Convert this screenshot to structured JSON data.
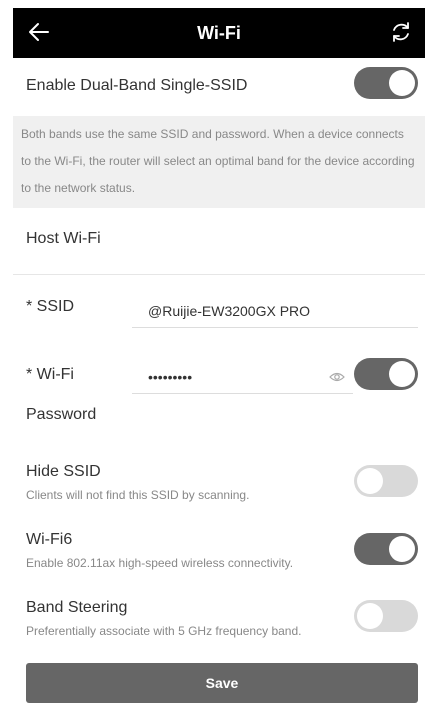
{
  "header": {
    "title": "Wi-Fi",
    "back_icon": "arrow-left-icon",
    "refresh_icon": "refresh-icon"
  },
  "dual_band": {
    "label": "Enable Dual-Band Single-SSID",
    "enabled": true,
    "description": "Both bands use the same SSID and password. When a device connects to the Wi-Fi, the router will select an optimal band for the device according to the network status."
  },
  "host_wifi": {
    "section_title": "Host Wi-Fi",
    "ssid_label": "* SSID",
    "ssid_value": "@Ruijie-EW3200GX PRO",
    "password_label_line1": "* Wi-Fi",
    "password_label_line2": "Password",
    "password_value": "•••••••••",
    "password_enabled": true,
    "eye_icon": "eye-icon"
  },
  "options": [
    {
      "title": "Hide SSID",
      "subtitle": "Clients will not find this SSID by scanning.",
      "enabled": false
    },
    {
      "title": "Wi-Fi6",
      "subtitle": "Enable 802.11ax high-speed wireless connectivity.",
      "enabled": true
    },
    {
      "title": "Band Steering",
      "subtitle": "Preferentially associate with 5 GHz frequency band.",
      "enabled": false
    }
  ],
  "save_label": "Save",
  "colors": {
    "header_bg": "#000000",
    "toggle_on": "#666666",
    "toggle_off": "#d9d9d9",
    "button_bg": "#666666",
    "desc_bg": "#f0f0f0"
  }
}
